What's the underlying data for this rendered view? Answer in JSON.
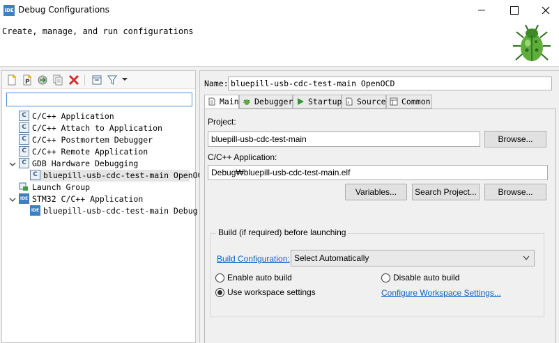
{
  "window": {
    "title": "Debug Configurations",
    "app_icon_text": "IDE"
  },
  "header": {
    "message": "Create, manage, and run configurations"
  },
  "left": {
    "filter_value": "",
    "tree": [
      {
        "label": "C/C++ Application",
        "icon": "c-launch-icon"
      },
      {
        "label": "C/C++ Attach to Application",
        "icon": "c-launch-icon"
      },
      {
        "label": "C/C++ Postmortem Debugger",
        "icon": "c-launch-icon"
      },
      {
        "label": "C/C++ Remote Application",
        "icon": "c-launch-icon"
      },
      {
        "label": "GDB Hardware Debugging",
        "icon": "c-launch-icon",
        "expanded": true
      },
      {
        "label": "bluepill-usb-cdc-test-main OpenOCD",
        "icon": "c-launch-icon",
        "selected": true
      },
      {
        "label": "Launch Group",
        "icon": "launch-group-icon"
      },
      {
        "label": "STM32 C/C++ Application",
        "icon": "ide-icon",
        "expanded": true
      },
      {
        "label": "bluepill-usb-cdc-test-main Debug",
        "icon": "ide-icon"
      }
    ],
    "ide_icon_text": "IDE",
    "c_icon_text": "C"
  },
  "right": {
    "name_label": "Name:",
    "name_value": "bluepill-usb-cdc-test-main OpenOCD",
    "tabs": [
      {
        "label": "Main",
        "active": true
      },
      {
        "label": "Debugger"
      },
      {
        "label": "Startup"
      },
      {
        "label": "Source"
      },
      {
        "label": "Common"
      }
    ],
    "project_label": "Project:",
    "project_value": "bluepill-usb-cdc-test-main",
    "browse_label": "Browse...",
    "app_label": "C/C++ Application:",
    "app_value": "Debug₩bluepill-usb-cdc-test-main.elf",
    "variables_label": "Variables...",
    "search_project_label": "Search Project...",
    "browse2_label": "Browse...",
    "build_group_title": "Build (if required) before launching",
    "build_config_link": "Build Configuration:",
    "build_config_value": "Select Automatically",
    "enable_auto_build": "Enable auto build",
    "disable_auto_build": "Disable auto build",
    "use_workspace": "Use workspace settings",
    "configure_workspace_link": "Configure Workspace Settings..."
  }
}
